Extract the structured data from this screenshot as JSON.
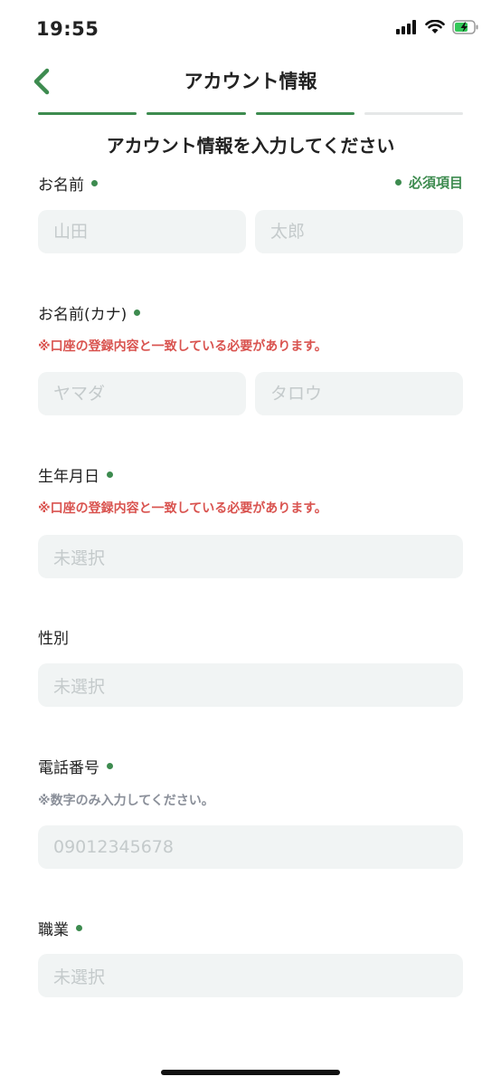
{
  "colors": {
    "accent": "#3d8b4f",
    "warning": "#d9534f",
    "hint": "#8a8f99",
    "field_bg": "#f1f4f4",
    "progress_inactive": "#e5e7e8"
  },
  "status_bar": {
    "time": "19:55",
    "icons": [
      "signal-icon",
      "wifi-icon",
      "battery-charging-icon"
    ]
  },
  "nav": {
    "back_icon": "chevron-left-icon",
    "title": "アカウント情報"
  },
  "progress": {
    "total_steps": 4,
    "completed_steps": 3
  },
  "form": {
    "heading": "アカウント情報を入力してください",
    "required_legend": "必須項目",
    "name": {
      "label": "お名前",
      "last_placeholder": "山田",
      "first_placeholder": "太郎"
    },
    "name_kana": {
      "label": "お名前(カナ)",
      "note": "※口座の登録内容と一致している必要があります。",
      "last_placeholder": "ヤマダ",
      "first_placeholder": "タロウ"
    },
    "birthdate": {
      "label": "生年月日",
      "note": "※口座の登録内容と一致している必要があります。",
      "placeholder": "未選択"
    },
    "gender": {
      "label": "性別",
      "placeholder": "未選択"
    },
    "phone": {
      "label": "電話番号",
      "note": "※数字のみ入力してください。",
      "placeholder": "09012345678"
    },
    "occupation": {
      "label": "職業",
      "placeholder": "未選択"
    }
  }
}
